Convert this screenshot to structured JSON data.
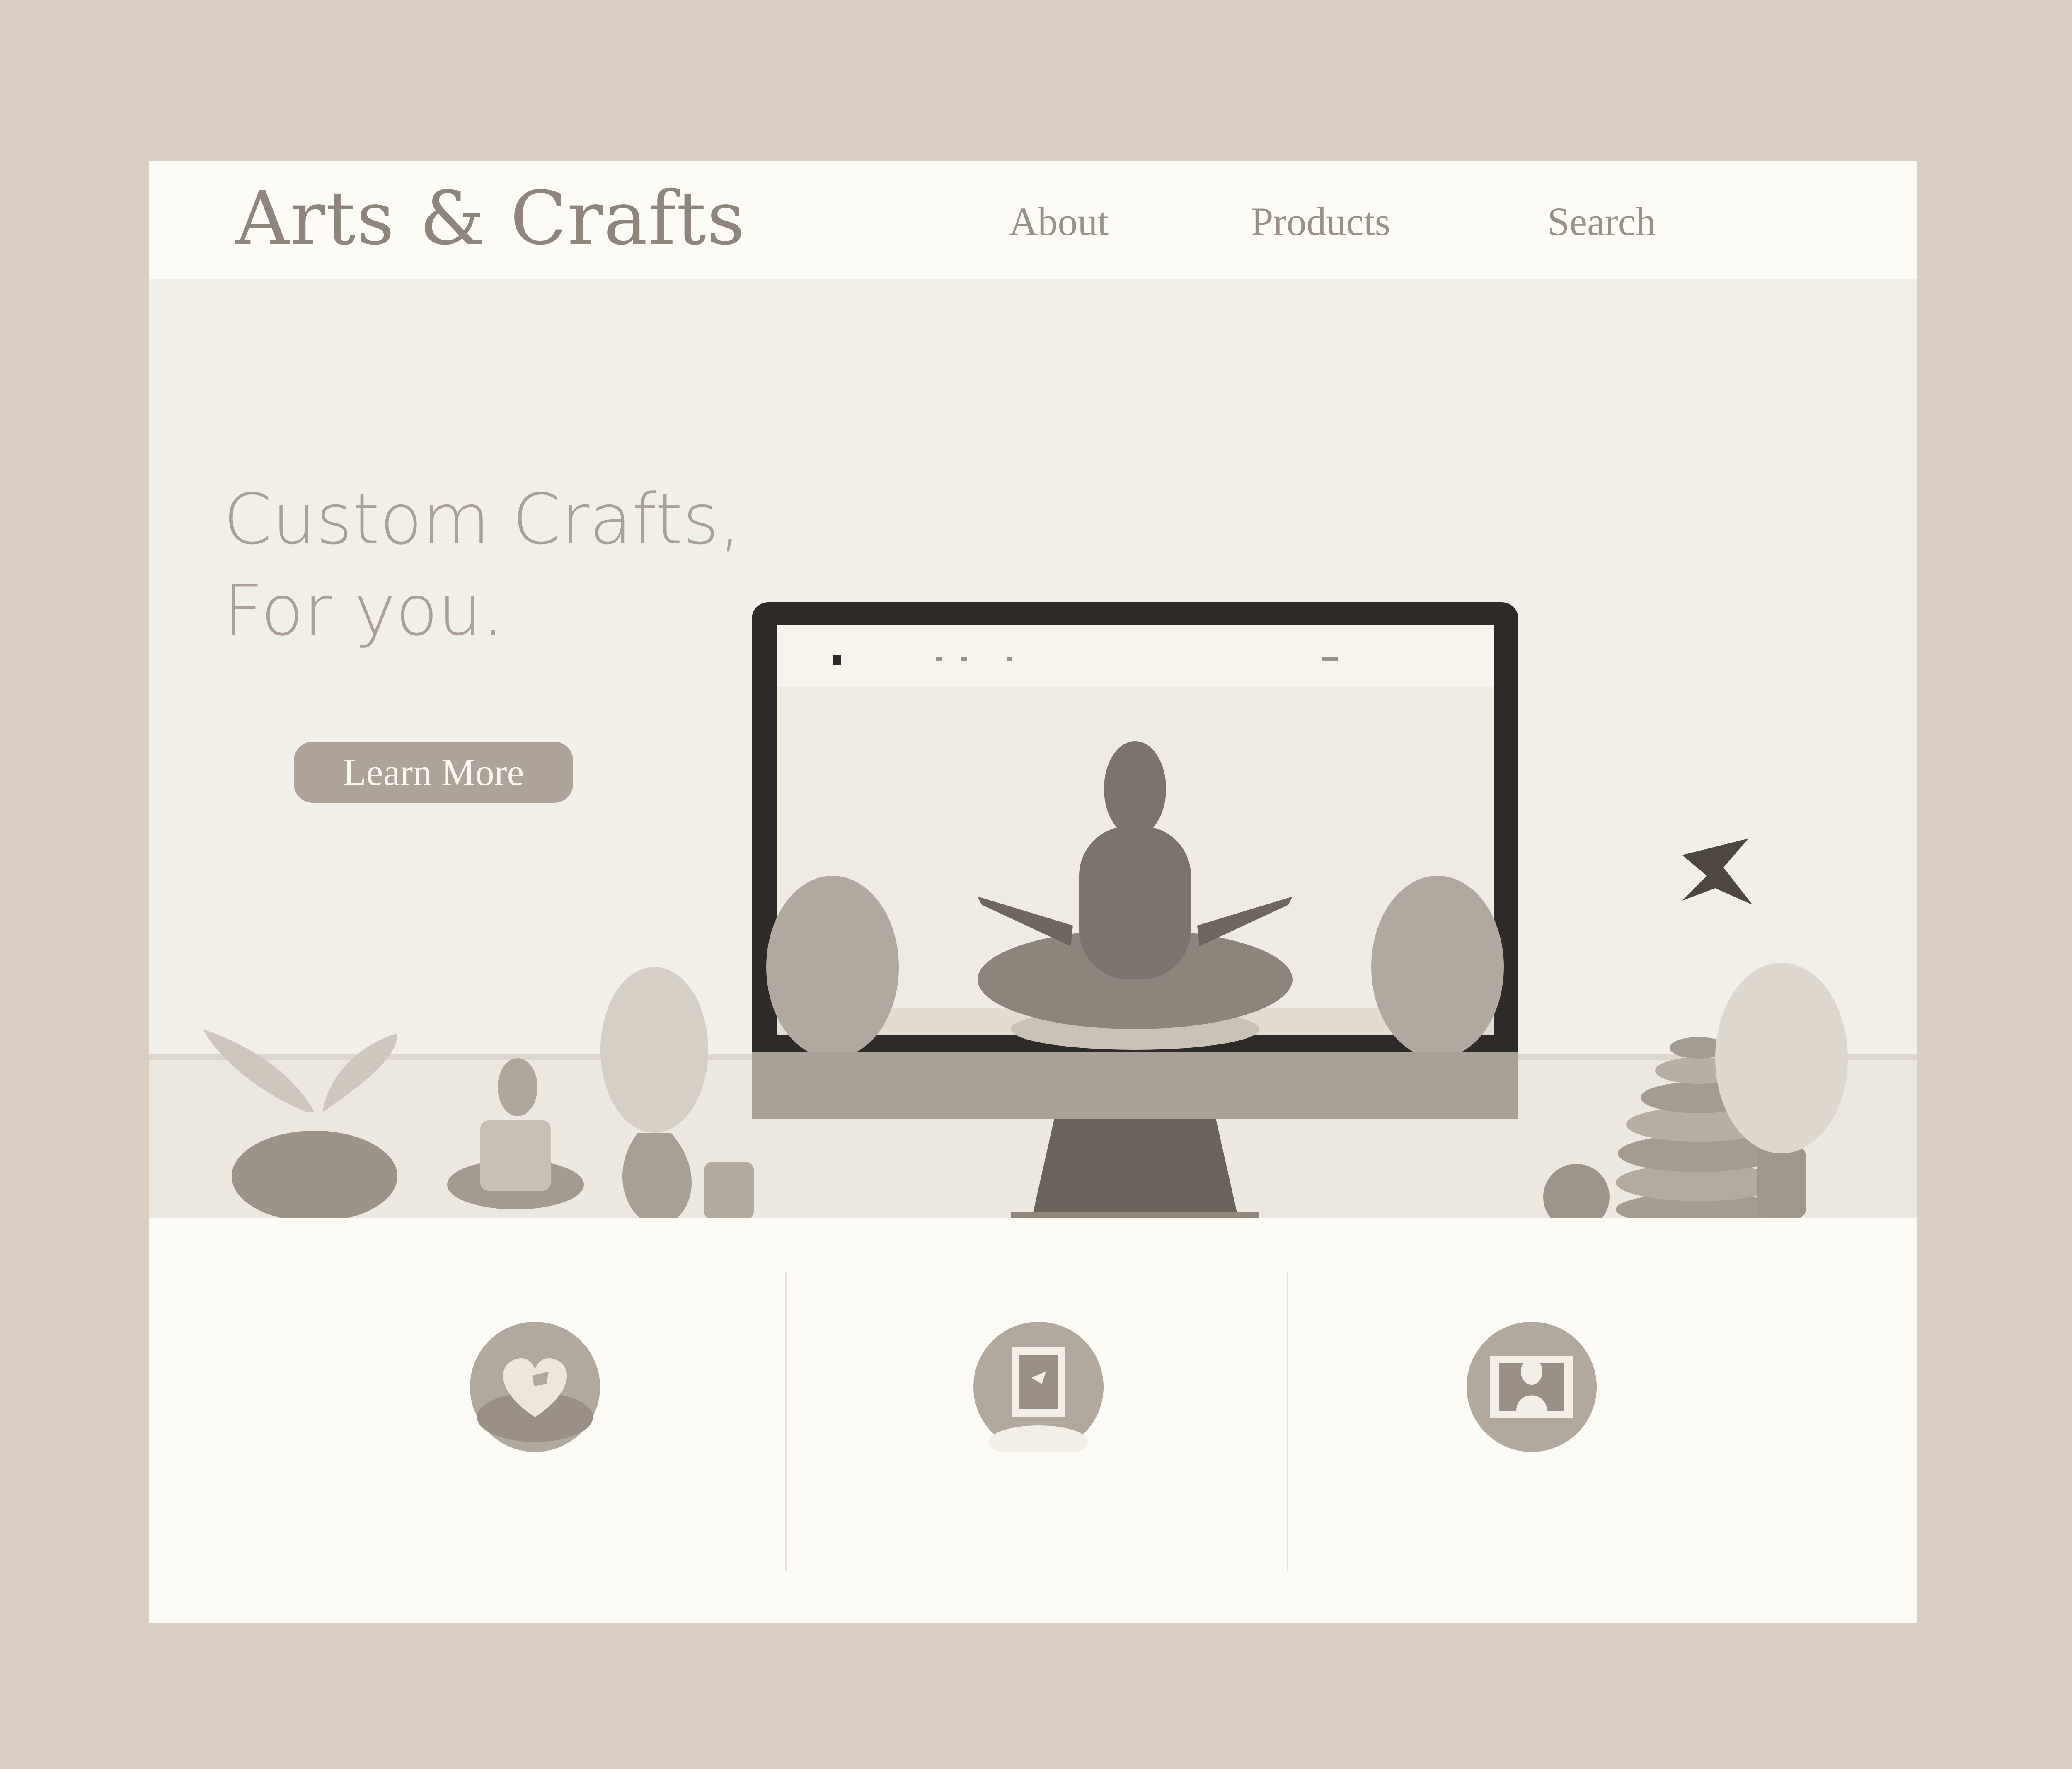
{
  "header": {
    "brand": "Arts & Crafts",
    "nav": [
      {
        "label": "About"
      },
      {
        "label": "Products"
      },
      {
        "label": "Search"
      }
    ]
  },
  "hero": {
    "tagline_line1": "Custom Crafts,",
    "tagline_line2": "For you.",
    "cta_label": "Learn More"
  },
  "features": {
    "icons": [
      "heart-icon",
      "picture-frame-icon",
      "portrait-icon"
    ]
  },
  "colors": {
    "frame": "#d9cfc3",
    "page": "#fdfbf5",
    "hero_bg": "#f2efe8",
    "accent": "#aea398",
    "text_muted": "#8f857c"
  }
}
